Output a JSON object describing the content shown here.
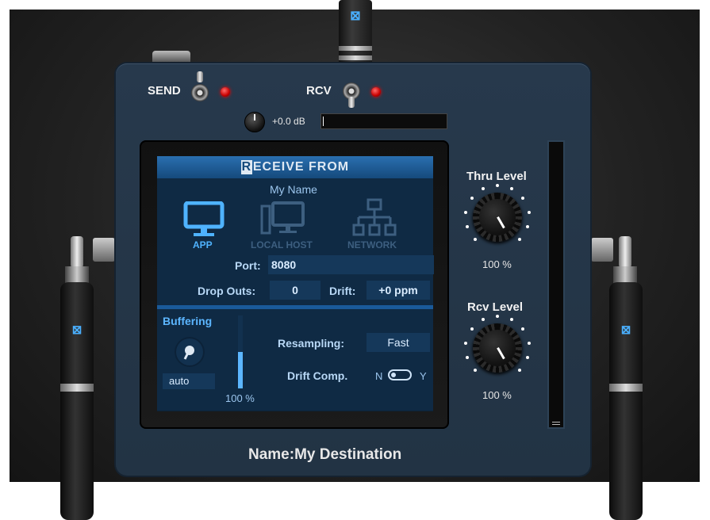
{
  "device": {
    "send_label": "SEND",
    "rcv_label": "RCV",
    "volume_readout": "+0.0 dB",
    "name_label": "Name:",
    "name_value": "My Destination"
  },
  "screen": {
    "header_initial": "R",
    "header_rest": "ECEIVE FROM",
    "source_name": "My Name",
    "devices": [
      {
        "label": "APP",
        "active": true,
        "icon": "monitor-icon"
      },
      {
        "label": "LOCAL HOST",
        "active": false,
        "icon": "desktop-icon"
      },
      {
        "label": "NETWORK",
        "active": false,
        "icon": "network-icon"
      }
    ],
    "port_label": "Port:",
    "port_value": "8080",
    "dropouts_label": "Drop Outs:",
    "dropouts_value": "0",
    "drift_label": "Drift:",
    "drift_value": "+0 ppm",
    "buffering_label": "Buffering",
    "buffering_mode": "auto",
    "buffer_level_text": "100 %",
    "buffer_level": 100,
    "resampling_label": "Resampling:",
    "resampling_value": "Fast",
    "drift_comp_label": "Drift Comp.",
    "drift_comp_n": "N",
    "drift_comp_y": "Y"
  },
  "knobs": {
    "thru_label": "Thru Level",
    "thru_value": "100 %",
    "rcv_label": "Rcv Level",
    "rcv_value": "100 %"
  },
  "colors": {
    "panel": "#27394c",
    "screen": "#0f2a44",
    "active_device": "#4fb3ff",
    "inactive_device": "#3d5f80",
    "led": "#e00000"
  }
}
